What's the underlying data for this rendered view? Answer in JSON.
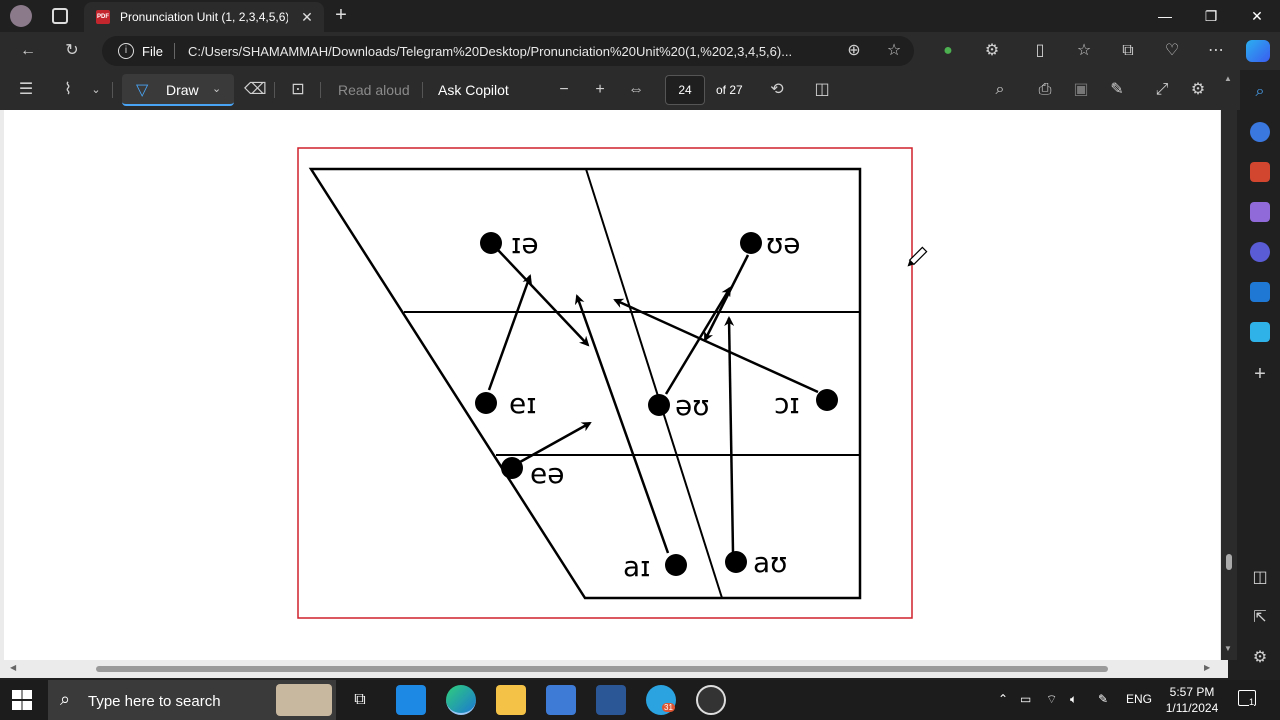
{
  "browser": {
    "tab_title": "Pronunciation Unit (1, 2,3,4,5,6)",
    "address_scheme": "File",
    "address": "C:/Users/SHAMAMMAH/Downloads/Telegram%20Desktop/Pronunciation%20Unit%20(1,%202,3,4,5,6)...",
    "pdf_icon": "PDF"
  },
  "pdf_toolbar": {
    "draw_label": "Draw",
    "read_aloud_label": "Read aloud",
    "ask_copilot_label": "Ask Copilot",
    "current_page": "24",
    "total_pages": "of 27"
  },
  "diagram": {
    "frame_color": "#d0212c",
    "labels": {
      "ia": "ɪə",
      "ua": "ʊə",
      "ei": "eɪ",
      "au_o": "əʊ",
      "oi": "ɔɪ",
      "ea": "eə",
      "ai": "aɪ",
      "au": "aʊ"
    }
  },
  "taskbar": {
    "search_placeholder": "Type here to search",
    "language": "ENG",
    "time": "5:57 PM",
    "date": "1/11/2024",
    "telegram_badge": "31",
    "notification_count": "1"
  }
}
